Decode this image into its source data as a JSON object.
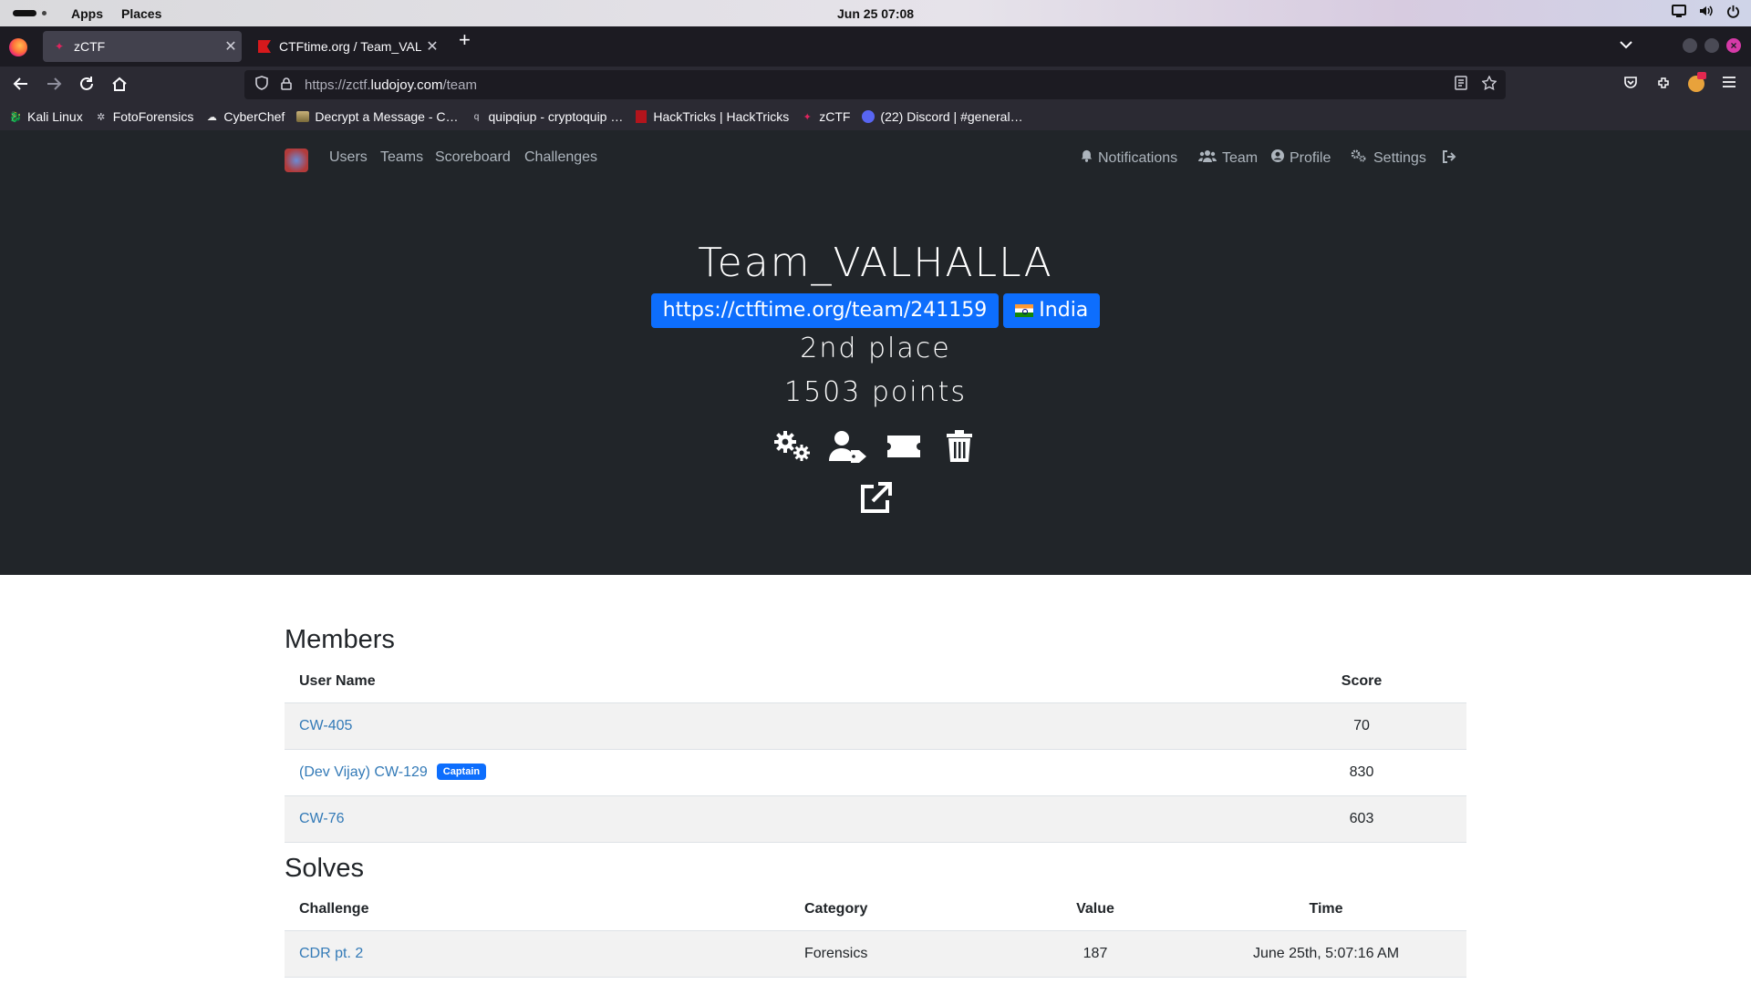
{
  "os": {
    "apps": "Apps",
    "places": "Places",
    "clock": "Jun 25  07:08"
  },
  "browser": {
    "tabs": [
      {
        "title": "zCTF",
        "active": true
      },
      {
        "title": "CTFtime.org / Team_VALI",
        "active": false
      }
    ],
    "url_prefix": "https://zctf.",
    "url_domain": "ludojoy.com",
    "url_path": "/team",
    "bookmarks": [
      "Kali Linux",
      "FotoForensics",
      "CyberChef",
      "Decrypt a Message - C…",
      "quipqiup - cryptoquip …",
      "HackTricks | HackTricks",
      "zCTF",
      "(22) Discord | #general…"
    ]
  },
  "site_nav": {
    "left": [
      "Users",
      "Teams",
      "Scoreboard",
      "Challenges"
    ],
    "right": [
      "Notifications",
      "Team",
      "Profile",
      "Settings"
    ]
  },
  "team": {
    "name": "Team_VALHALLA",
    "website": "https://ctftime.org/team/241159",
    "country": "India",
    "place": "2nd place",
    "points": "1503 points"
  },
  "members": {
    "title": "Members",
    "headers": {
      "user": "User Name",
      "score": "Score"
    },
    "rows": [
      {
        "name": "CW-405",
        "score": "70",
        "captain": ""
      },
      {
        "name": "(Dev Vijay) CW-129",
        "score": "830",
        "captain": "Captain"
      },
      {
        "name": "CW-76",
        "score": "603",
        "captain": ""
      }
    ]
  },
  "solves": {
    "title": "Solves",
    "headers": {
      "challenge": "Challenge",
      "category": "Category",
      "value": "Value",
      "time": "Time"
    },
    "rows": [
      {
        "challenge": "CDR pt. 2",
        "category": "Forensics",
        "value": "187",
        "time": "June 25th, 5:07:16 AM"
      }
    ]
  }
}
